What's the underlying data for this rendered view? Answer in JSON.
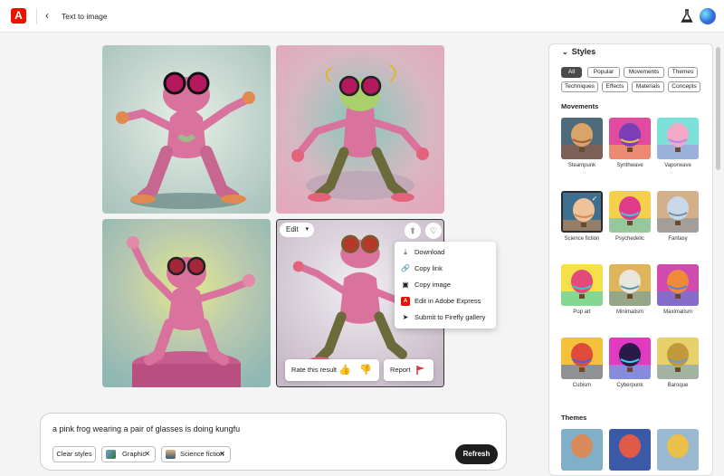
{
  "header": {
    "logo_letter": "A",
    "back_icon": "‹",
    "title": "Text to image"
  },
  "image_card": {
    "edit_label": "Edit",
    "menu": [
      {
        "icon": "download-icon",
        "label": "Download"
      },
      {
        "icon": "link-icon",
        "label": "Copy link"
      },
      {
        "icon": "clipboard-icon",
        "label": "Copy image"
      },
      {
        "icon": "adobe-express-icon",
        "label": "Edit in Adobe Express"
      },
      {
        "icon": "send-icon",
        "label": "Submit to Firefly gallery"
      }
    ],
    "rate_label": "Rate this result",
    "report_label": "Report"
  },
  "prompt": {
    "text": "a pink frog wearing a pair of glasses is doing kungfu",
    "chips": {
      "clear": "Clear styles",
      "graphic": "Graphic",
      "scifi": "Science fiction"
    },
    "refresh_label": "Refresh"
  },
  "styles_panel": {
    "title": "Styles",
    "filters": [
      "All",
      "Popular",
      "Movements",
      "Themes",
      "Techniques",
      "Effects",
      "Materials",
      "Concepts"
    ],
    "active_filter": "All",
    "movements_heading": "Movements",
    "themes_heading": "Themes",
    "movements": [
      "Steampunk",
      "Synthwave",
      "Vaporwave",
      "Science fiction",
      "Psychedelic",
      "Fantasy",
      "Pop art",
      "Minimalism",
      "Maximalism",
      "Cubism",
      "Cyberpunk",
      "Baroque"
    ],
    "selected_movement": "Science fiction"
  },
  "colors": {
    "brand": "#eb1000",
    "frog_pink": "#d9739e",
    "refresh_bg": "#1e1e1e",
    "rating_yellow": "#e8a200",
    "report_red": "#d7373f"
  }
}
